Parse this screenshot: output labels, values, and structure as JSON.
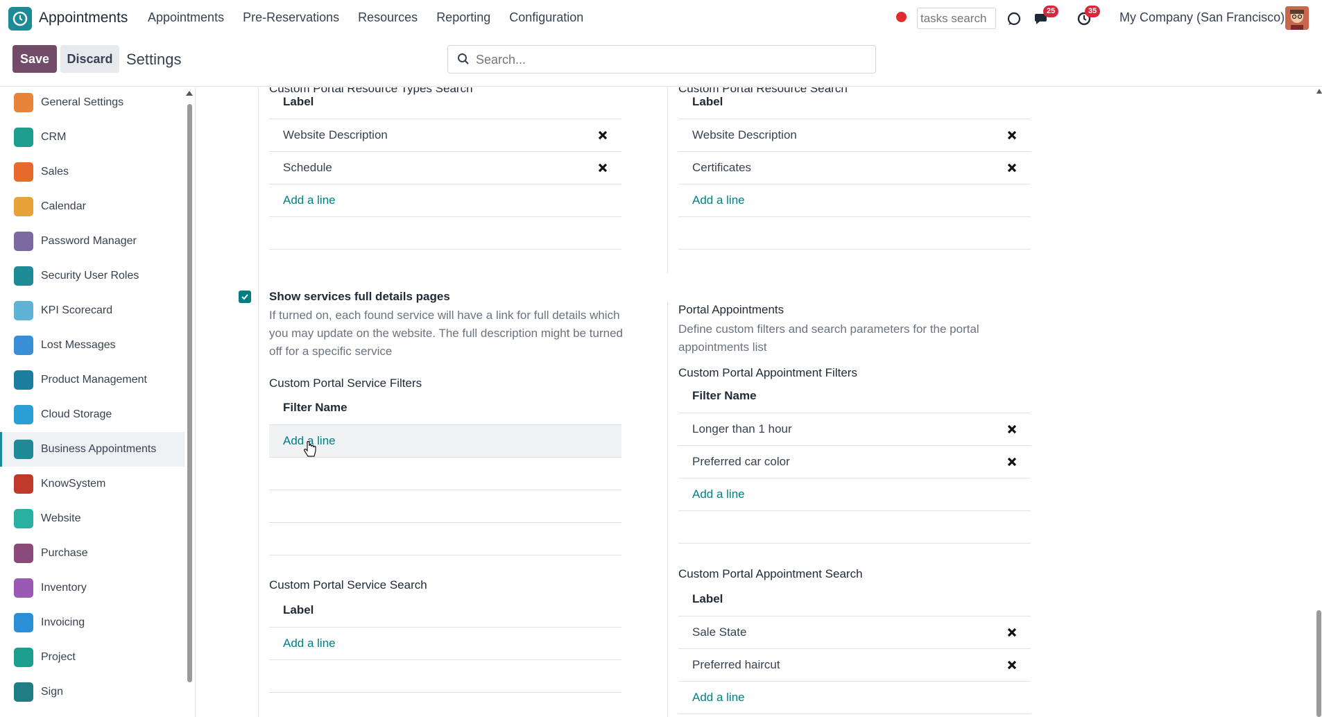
{
  "topbar": {
    "app_name": "Appointments",
    "nav": [
      "Appointments",
      "Pre-Reservations",
      "Resources",
      "Reporting",
      "Configuration"
    ],
    "tasks_search_placeholder": "tasks search",
    "messages_badge": "25",
    "activities_badge": "35",
    "company": "My Company (San Francisco)"
  },
  "controls": {
    "save": "Save",
    "discard": "Discard",
    "title": "Settings",
    "search_placeholder": "Search..."
  },
  "sidebar": {
    "items": [
      {
        "label": "General Settings",
        "icon": "general-settings-icon",
        "color": "#e8833a"
      },
      {
        "label": "CRM",
        "icon": "crm-icon",
        "color": "#1e9e8f"
      },
      {
        "label": "Sales",
        "icon": "sales-icon",
        "color": "#e66a2c"
      },
      {
        "label": "Calendar",
        "icon": "calendar-icon",
        "color": "#e8a23a"
      },
      {
        "label": "Password Manager",
        "icon": "password-manager-icon",
        "color": "#7a6aa0"
      },
      {
        "label": "Security User Roles",
        "icon": "security-roles-icon",
        "color": "#1e8a95"
      },
      {
        "label": "KPI Scorecard",
        "icon": "kpi-scorecard-icon",
        "color": "#5fb3d4"
      },
      {
        "label": "Lost Messages",
        "icon": "lost-messages-icon",
        "color": "#3a8fd4"
      },
      {
        "label": "Product Management",
        "icon": "product-management-icon",
        "color": "#1e7ea0"
      },
      {
        "label": "Cloud Storage",
        "icon": "cloud-storage-icon",
        "color": "#2a9fd6"
      },
      {
        "label": "Business Appointments",
        "icon": "appointments-icon",
        "color": "#1e8a95"
      },
      {
        "label": "KnowSystem",
        "icon": "knowsystem-icon",
        "color": "#c0392b"
      },
      {
        "label": "Website",
        "icon": "website-icon",
        "color": "#2ab0a0"
      },
      {
        "label": "Purchase",
        "icon": "purchase-icon",
        "color": "#8a4a7a"
      },
      {
        "label": "Inventory",
        "icon": "inventory-icon",
        "color": "#9b59b6"
      },
      {
        "label": "Invoicing",
        "icon": "invoicing-icon",
        "color": "#2a8fd4"
      },
      {
        "label": "Project",
        "icon": "project-icon",
        "color": "#1e9e8f"
      },
      {
        "label": "Sign",
        "icon": "sign-icon",
        "color": "#1e7e84"
      }
    ],
    "active_index": 10
  },
  "left": {
    "resource_types_search": {
      "title": "Custom Portal Resource Types Search",
      "header": "Label",
      "rows": [
        "Website Description",
        "Schedule"
      ],
      "add_line": "Add a line"
    },
    "show_services": {
      "title": "Show services full details pages",
      "description": "If turned on, each found service will have a link for full details which you may update on the website. The full description might be turned off for a specific service"
    },
    "service_filters": {
      "title": "Custom Portal Service Filters",
      "header": "Filter Name",
      "add_line": "Add a line"
    },
    "service_search": {
      "title": "Custom Portal Service Search",
      "header": "Label",
      "add_line": "Add a line"
    }
  },
  "right": {
    "resource_search": {
      "title": "Custom Portal Resource Search",
      "header": "Label",
      "rows": [
        "Website Description",
        "Certificates"
      ],
      "add_line": "Add a line"
    },
    "portal_appointments": {
      "title": "Portal Appointments",
      "description": "Define custom filters and search parameters for the portal appointments list"
    },
    "appointment_filters": {
      "title": "Custom Portal Appointment Filters",
      "header": "Filter Name",
      "rows": [
        "Longer than 1 hour",
        "Preferred car color"
      ],
      "add_line": "Add a line"
    },
    "appointment_search": {
      "title": "Custom Portal Appointment Search",
      "header": "Label",
      "rows": [
        "Sale State",
        "Preferred haircut"
      ],
      "add_line": "Add a line"
    }
  },
  "colors": {
    "primary": "#714b67",
    "link": "#017e84",
    "accent": "#1e8a95",
    "badge": "#d9263a"
  }
}
